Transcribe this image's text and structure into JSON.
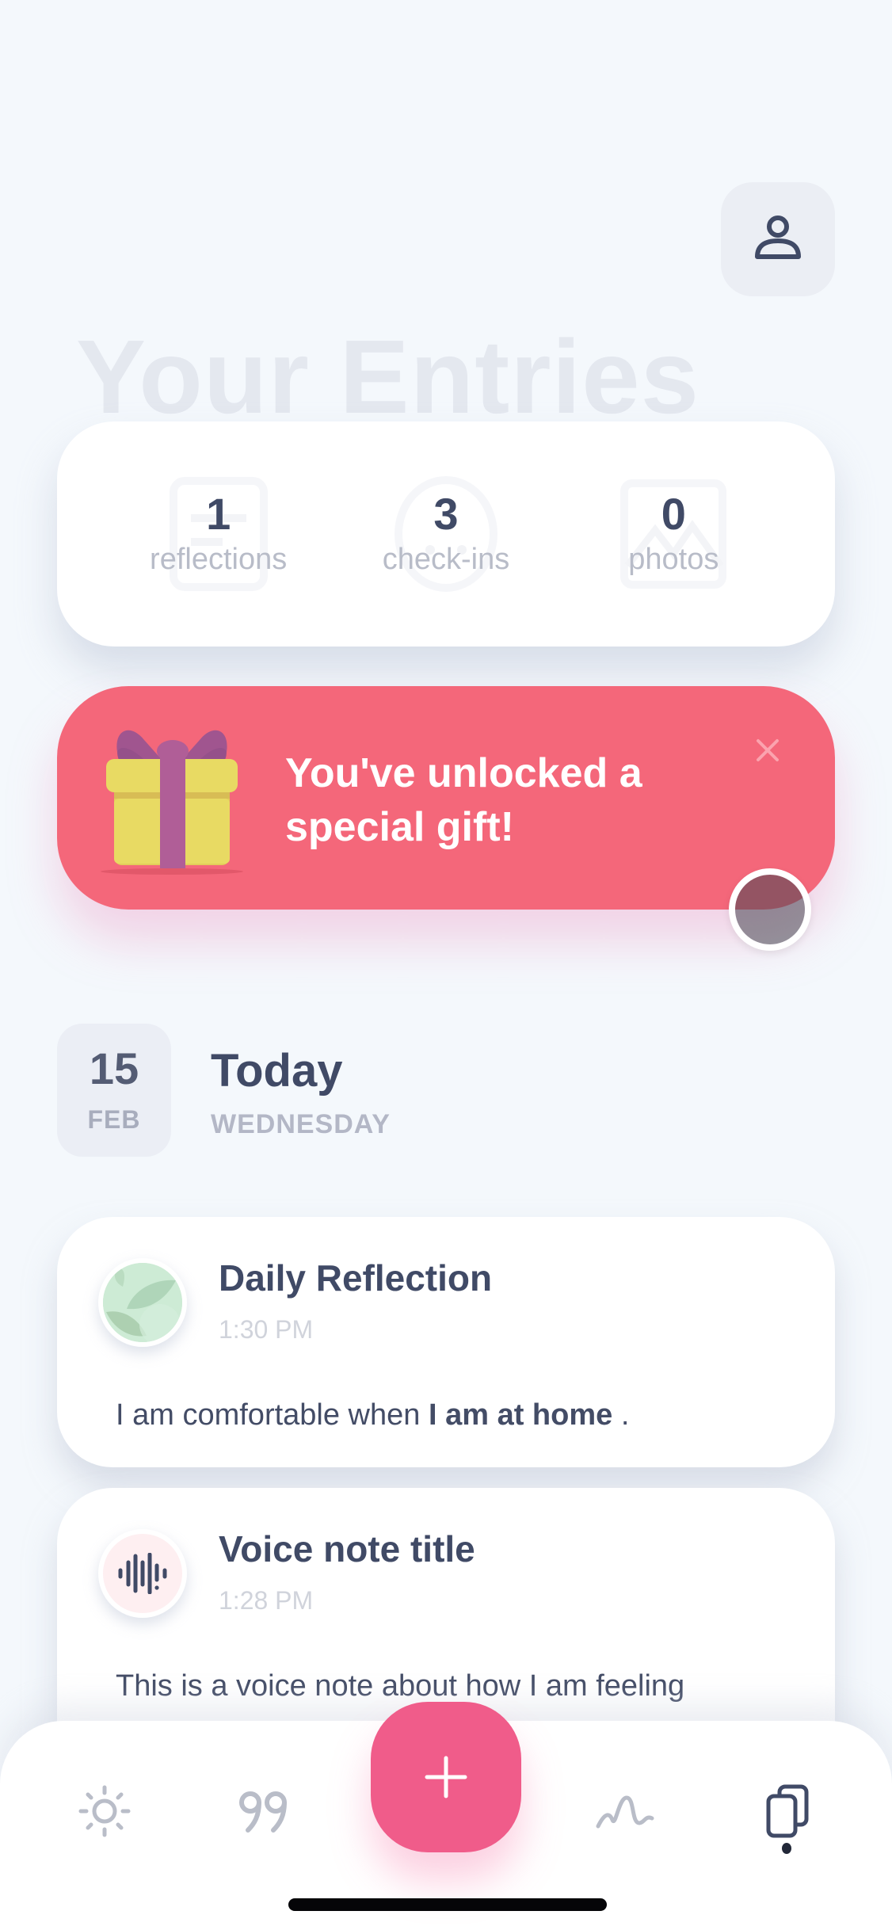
{
  "header": {
    "title": "Your Entries",
    "profile_button_icon": "user-icon"
  },
  "stats": [
    {
      "count": "1",
      "label": "reflections",
      "icon": "document-icon"
    },
    {
      "count": "3",
      "label": "check-ins",
      "icon": "smiley-icon"
    },
    {
      "count": "0",
      "label": "photos",
      "icon": "image-icon"
    }
  ],
  "gift_banner": {
    "line1": "You've unlocked a",
    "line2": "special gift!",
    "icon": "gift-icon",
    "close_icon": "close-icon",
    "background_color": "#F4677A"
  },
  "date_header": {
    "day": "15",
    "month": "FEB",
    "title": "Today",
    "weekday": "WEDNESDAY"
  },
  "entries": [
    {
      "title": "Daily Reflection",
      "time": "1:30 PM",
      "icon": "leaf-icon",
      "body_prefix": "I am comfortable when ",
      "body_bold": "I am at home",
      "body_suffix": " ."
    },
    {
      "title": "Voice note title",
      "time": "1:28 PM",
      "icon": "soundwave-icon",
      "body": "This is a voice note about how I am feeling"
    }
  ],
  "bottom_nav": {
    "items": [
      {
        "name": "today",
        "icon": "sun-icon",
        "active": false
      },
      {
        "name": "quotes",
        "icon": "quote-icon",
        "active": false
      },
      {
        "name": "insights",
        "icon": "wave-icon",
        "active": false
      },
      {
        "name": "entries",
        "icon": "copy-icon",
        "active": true
      }
    ],
    "fab_icon": "plus-icon",
    "accent_color": "#F05C8A"
  }
}
